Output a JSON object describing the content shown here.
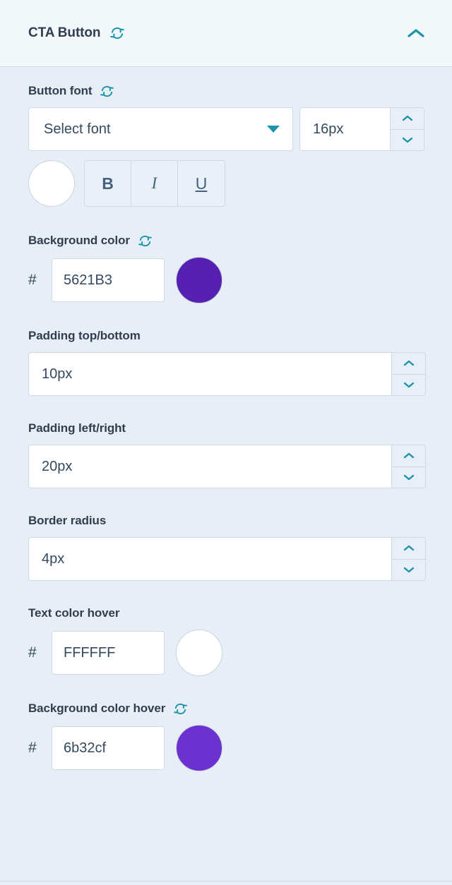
{
  "header": {
    "title": "CTA Button",
    "reset_icon": "reset-sync-icon",
    "collapse_icon": "chevron-up-icon"
  },
  "colors": {
    "accent_teal": "#1a93ad",
    "panel_bg": "#e7eef6",
    "header_bg": "#f3f8fb",
    "label_text": "#2f3e50",
    "background_color_swatch": "#5621B3",
    "text_color_hover_swatch": "#FFFFFF",
    "background_color_hover_swatch": "#6b32cf",
    "font_color_swatch": "#FFFFFF"
  },
  "fields": {
    "button_font": {
      "label": "Button font",
      "has_reset": true,
      "select_value": "Select font",
      "size_value": "16px",
      "styles": {
        "bold": "B",
        "italic": "I",
        "underline": "U"
      }
    },
    "background_color": {
      "label": "Background color",
      "has_reset": true,
      "hash": "#",
      "value": "5621B3"
    },
    "padding_top_bottom": {
      "label": "Padding top/bottom",
      "has_reset": false,
      "value": "10px"
    },
    "padding_left_right": {
      "label": "Padding left/right",
      "has_reset": false,
      "value": "20px"
    },
    "border_radius": {
      "label": "Border radius",
      "has_reset": false,
      "value": "4px"
    },
    "text_color_hover": {
      "label": "Text color hover",
      "has_reset": false,
      "hash": "#",
      "value": "FFFFFF"
    },
    "background_color_hover": {
      "label": "Background color hover",
      "has_reset": true,
      "hash": "#",
      "value": "6b32cf"
    }
  }
}
